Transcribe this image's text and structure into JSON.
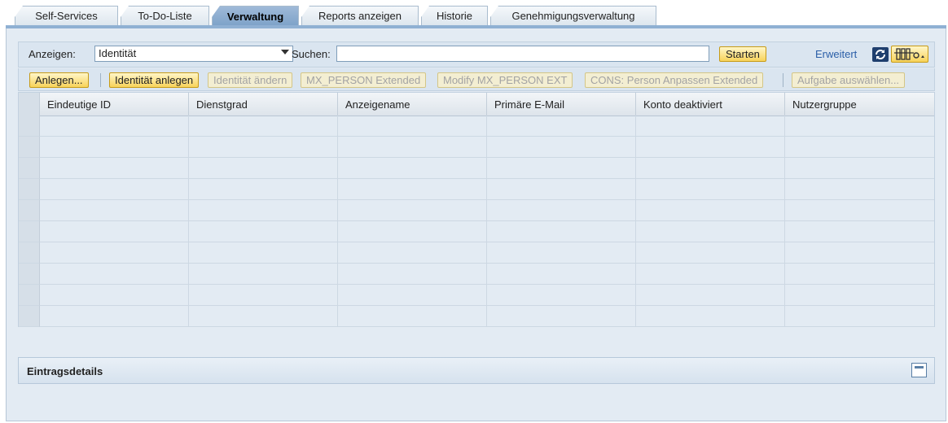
{
  "tabs": [
    {
      "label": "Self-Services",
      "active": false
    },
    {
      "label": "To-Do-Liste",
      "active": false
    },
    {
      "label": "Verwaltung",
      "active": true
    },
    {
      "label": "Reports anzeigen",
      "active": false
    },
    {
      "label": "Historie",
      "active": false
    },
    {
      "label": "Genehmigungsverwaltung",
      "active": false
    }
  ],
  "filter": {
    "show_label": "Anzeigen:",
    "show_value": "Identität",
    "search_label": "Suchen:",
    "search_value": "",
    "start_button": "Starten",
    "advanced_link": "Erweitert",
    "refresh_icon": "refresh-icon",
    "settings_icon": "table-settings-icon"
  },
  "actions": {
    "create_menu": "Anlegen...",
    "create_identity": "Identität anlegen",
    "change_identity": "Identität ändern",
    "mx_person_extended": "MX_PERSON Extended",
    "modify_mx_person_ext": "Modify MX_PERSON EXT",
    "cons_person_adjust": "CONS: Person Anpassen Extended",
    "select_task": "Aufgabe auswählen..."
  },
  "table": {
    "columns": [
      "Eindeutige ID",
      "Dienstgrad",
      "Anzeigename",
      "Primäre E-Mail",
      "Konto deaktiviert",
      "Nutzergruppe"
    ],
    "rows": [
      [],
      [],
      [],
      [],
      [],
      [],
      [],
      [],
      [],
      []
    ]
  },
  "details": {
    "title": "Eintragsdetails"
  },
  "colors": {
    "active_tab": "#7da2c8",
    "button_yellow": "#f8d35a",
    "panel_bg": "#e3ebf3",
    "link": "#2b5fa8"
  }
}
